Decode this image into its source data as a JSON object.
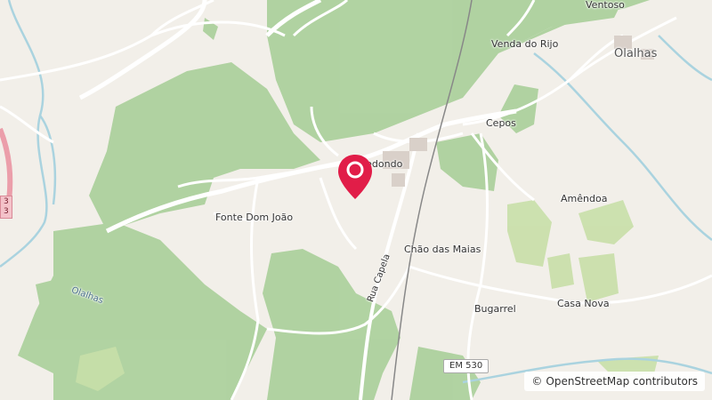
{
  "map": {
    "places": {
      "ventoso": "Ventoso",
      "venda_do_rijo": "Venda do Rijo",
      "olalhas_town": "Olalhas",
      "cepos": "Cepos",
      "redondo": "Redondo",
      "fonte_dom_joao": "Fonte Dom João",
      "amendoa": "Amêndoa",
      "chao_das_maias": "Chão das Maias",
      "bugarrel": "Bugarrel",
      "casa_nova": "Casa Nova",
      "olalhas_stream": "Olalhas",
      "rua_capela": "Rua Capela"
    },
    "road_ref": "EM 530",
    "edge_badge": [
      "3",
      "3"
    ],
    "marker_icon": "map-pin-icon",
    "colors": {
      "land": "#f2efe9",
      "forest": "#add19e",
      "water": "#aad3df",
      "marker": "#e11d48"
    }
  },
  "attribution": {
    "symbol": "©",
    "text": "OpenStreetMap contributors"
  }
}
